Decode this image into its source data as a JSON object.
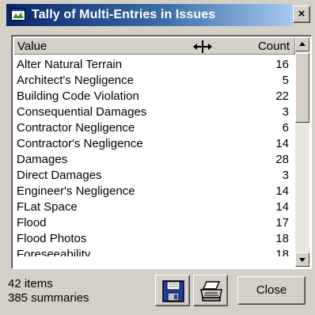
{
  "window": {
    "title": "Tally of Multi-Entries in Issues",
    "close_glyph": "×"
  },
  "list": {
    "columns": {
      "value": "Value",
      "count": "Count"
    },
    "rows": [
      {
        "value": "Alter Natural Terrain",
        "count": "16"
      },
      {
        "value": "Architect's Negligence",
        "count": "5"
      },
      {
        "value": "Building Code Violation",
        "count": "22"
      },
      {
        "value": "Consequential Damages",
        "count": "3"
      },
      {
        "value": "Contractor Negligence",
        "count": "6"
      },
      {
        "value": "Contractor's Negligence",
        "count": "14"
      },
      {
        "value": "Damages",
        "count": "28"
      },
      {
        "value": "Direct Damages",
        "count": "3"
      },
      {
        "value": "Engineer's Negligence",
        "count": "14"
      },
      {
        "value": "FLat Space",
        "count": "14"
      },
      {
        "value": "Flood",
        "count": "17"
      },
      {
        "value": "Flood Photos",
        "count": "18"
      },
      {
        "value": "Foreseeability",
        "count": "18"
      }
    ]
  },
  "status": {
    "items": "42 items",
    "summaries": "385 summaries"
  },
  "buttons": {
    "close_label": "Close"
  },
  "colors": {
    "title_bar_start": "#0a246a",
    "title_bar_end": "#a6caf0",
    "face": "#d4d0c8",
    "save_icon": "#1f3fb0"
  },
  "icons": {
    "title": "window-icon",
    "save": "floppy-disk-icon",
    "print": "printer-icon",
    "header_cursor": "column-resize-cursor-icon"
  }
}
